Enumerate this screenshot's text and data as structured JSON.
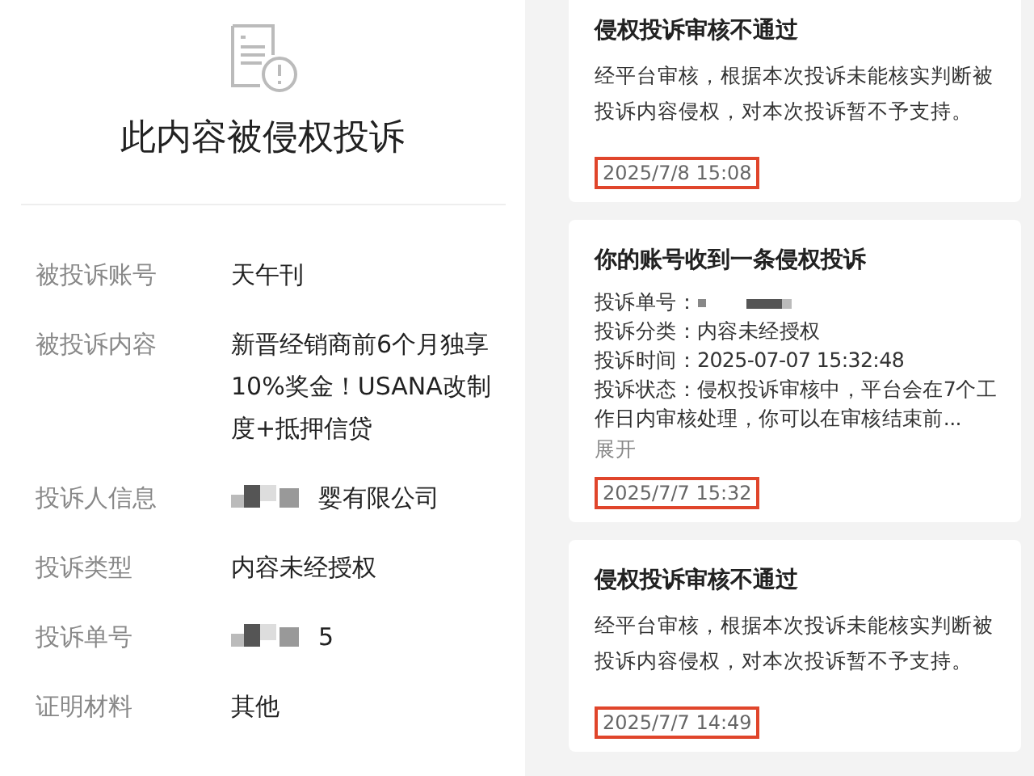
{
  "complaint": {
    "title": "此内容被侵权投诉",
    "rows": [
      {
        "label": "被投诉账号",
        "value": "天午刊",
        "redacted": false
      },
      {
        "label": "被投诉内容",
        "value": "新晋经销商前6个月独享10%奖金！USANA改制度+抵押信贷",
        "redacted": false
      },
      {
        "label": "投诉人信息",
        "value": "婴有限公司",
        "redacted": true
      },
      {
        "label": "投诉类型",
        "value": "内容未经授权",
        "redacted": false
      },
      {
        "label": "投诉单号",
        "value": "5",
        "redacted": true
      },
      {
        "label": "证明材料",
        "value": "其他",
        "redacted": false
      }
    ]
  },
  "notifications": [
    {
      "kind": "text",
      "title": "侵权投诉审核不通过",
      "body": "经平台审核，根据本次投诉未能核实判断被投诉内容侵权，对本次投诉暂不予支持。",
      "time": "2025/7/8 15:08",
      "highlighted": true
    },
    {
      "kind": "fields",
      "title": "你的账号收到一条侵权投诉",
      "fields": [
        {
          "label": "投诉单号：",
          "redacted": true
        },
        {
          "label": "投诉分类：",
          "value": "内容未经授权",
          "redacted": false
        },
        {
          "label": "投诉时间：",
          "value": "2025-07-07 15:32:48",
          "redacted": false
        },
        {
          "label": "投诉状态：",
          "value": "侵权投诉审核中，平台会在7个工作日内审核处理，你可以在审核结束前...",
          "redacted": false
        }
      ],
      "expand": "展开",
      "time": "2025/7/7 15:32",
      "highlighted": true
    },
    {
      "kind": "text",
      "title": "侵权投诉审核不通过",
      "body": "经平台审核，根据本次投诉未能核实判断被投诉内容侵权，对本次投诉暂不予支持。",
      "time": "2025/7/7 14:49",
      "highlighted": true
    }
  ]
}
